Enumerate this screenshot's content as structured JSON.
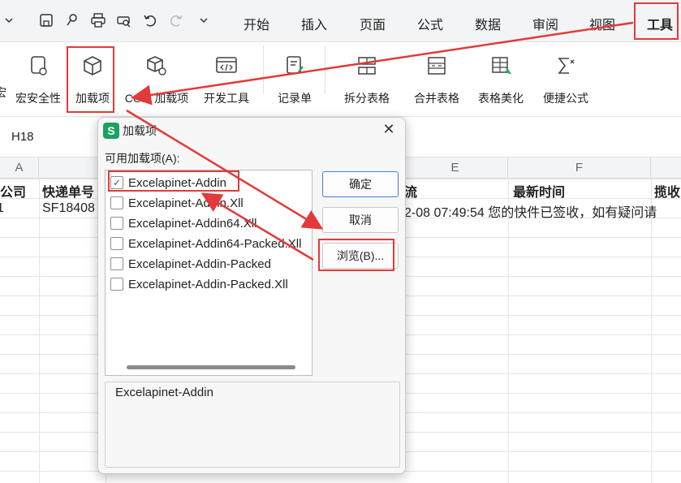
{
  "quick_access": [
    {
      "icon": "chevron-down-icon"
    },
    {
      "icon": "save-icon"
    },
    {
      "icon": "format-painter-icon"
    },
    {
      "icon": "print-icon"
    },
    {
      "icon": "print-preview-icon"
    },
    {
      "icon": "undo-icon"
    },
    {
      "icon": "redo-icon"
    },
    {
      "icon": "chevron-down-icon"
    }
  ],
  "menu": {
    "tabs": [
      "开始",
      "插入",
      "页面",
      "公式",
      "数据",
      "审阅",
      "视图",
      "工具"
    ],
    "active": "工具"
  },
  "ribbon": {
    "items": [
      {
        "label": "宏安全性",
        "icon": "shield-icon"
      },
      {
        "label": "加载项",
        "icon": "cube-icon"
      },
      {
        "label": "COM 加载项",
        "icon": "cube-gear-icon"
      },
      {
        "label": "开发工具",
        "icon": "code-window-icon"
      },
      {
        "label": "记录单",
        "icon": "form-icon"
      },
      {
        "label": "拆分表格",
        "icon": "split-table-icon"
      },
      {
        "label": "合并表格",
        "icon": "merge-table-icon"
      },
      {
        "label": "表格美化",
        "icon": "table-beautify-icon"
      },
      {
        "label": "便捷公式",
        "icon": "sum-icon"
      }
    ],
    "cut_label": "宏"
  },
  "namebox": {
    "cell": "H18"
  },
  "sheet": {
    "columns": [
      "A",
      "E",
      "F"
    ],
    "header_row": [
      "公司",
      "快递单号",
      "流",
      "最新时间",
      "揽收"
    ],
    "row1": [
      "1",
      "SF18408",
      "2-08 07:49:54 您的快件已签收，如有疑问请"
    ]
  },
  "dialog": {
    "title": "加载项",
    "list_label": "可用加载项(A):",
    "items": [
      {
        "name": "Excelapinet-Addin",
        "checked": "✓"
      },
      {
        "name": "Excelapinet-Addin.Xll",
        "checked": ""
      },
      {
        "name": "Excelapinet-Addin64.Xll",
        "checked": ""
      },
      {
        "name": "Excelapinet-Addin64-Packed.Xll",
        "checked": ""
      },
      {
        "name": "Excelapinet-Addin-Packed",
        "checked": ""
      },
      {
        "name": "Excelapinet-Addin-Packed.Xll",
        "checked": ""
      }
    ],
    "ok": "确定",
    "cancel": "取消",
    "browse": "浏览(B)...",
    "description": "Excelapinet-Addin"
  },
  "colors": {
    "accent": "#e23a3a",
    "primary": "#3f7ee0",
    "logo": "#1aa260"
  }
}
